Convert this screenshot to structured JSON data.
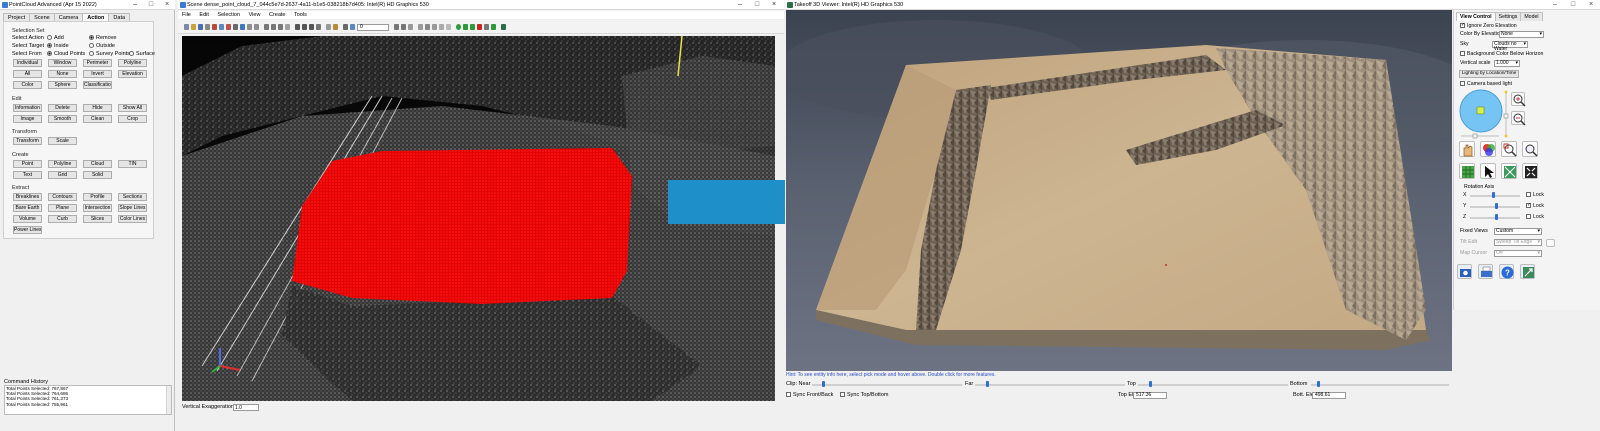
{
  "left_window": {
    "title": "PointCloud Advanced (Apr 15 2022)",
    "tabs": [
      "Project",
      "Scene",
      "Camera",
      "Action",
      "Data"
    ],
    "active_tab": "Action",
    "selection_set": {
      "heading": "Selection Set",
      "select_action_label": "Select Action",
      "action_add": "Add",
      "action_remove": "Remove",
      "select_target_label": "Select Target",
      "target_inside": "Inside",
      "target_outside": "Outside",
      "select_from_label": "Select From",
      "from_cloud": "Cloud Points",
      "from_survey": "Survey Points",
      "from_surface": "Surface",
      "buttons": [
        "Individual",
        "Window",
        "Perimeter",
        "Polyline",
        "All",
        "None",
        "Invert",
        "Elevation",
        "Color",
        "Sphere",
        "Classification"
      ]
    },
    "edit": {
      "heading": "Edit",
      "buttons": [
        "Information",
        "Delete",
        "Hide",
        "Show All",
        "Image",
        "Smooth",
        "Clean",
        "Crop"
      ]
    },
    "transform": {
      "heading": "Transform",
      "buttons": [
        "Transform",
        "Scale"
      ]
    },
    "create": {
      "heading": "Create",
      "buttons": [
        "Point",
        "Polyline",
        "Cloud",
        "TIN",
        "Text",
        "Grid",
        "Solid"
      ]
    },
    "extract": {
      "heading": "Extract",
      "buttons": [
        "Breaklines",
        "Contours",
        "Profile",
        "Sections",
        "Bare Earth",
        "Plane",
        "Intersection",
        "Slope Lines",
        "Volume",
        "Curb",
        "Slices",
        "Color Lines",
        "Power Lines"
      ]
    },
    "history": {
      "label": "Command History",
      "lines": [
        "Total Points Selected: 767,867",
        "Total Points Selected: 764,686",
        "Total Points Selected: 761,373",
        "Total Points Selected: 755,961"
      ]
    }
  },
  "scene_window": {
    "title": "Scene dense_point_cloud_7_044c5e7d-2637-4a11-b1e5-038218b7d405: Intel(R) HD Graphics 530",
    "menu": [
      "File",
      "Edit",
      "Selection",
      "View",
      "Create",
      "Tools"
    ],
    "toolbar_field": "0",
    "vertical_exag_label": "Vertical Exaggeration",
    "vertical_exag_value": "1.0"
  },
  "takeoff_window": {
    "title": "Takeoff 3D Viewer: Intel(R) HD Graphics 530",
    "hint": "Hint: To see entity info here, select pick mode and hover above. Double click for more features.",
    "clip_near": "Clip: Near",
    "far": "Far",
    "top": "Top",
    "bottom": "Bottom",
    "sync_front_back": "Sync Front/Back",
    "sync_top_bottom": "Sync Top/Bottom",
    "top_elev_label": "Top Elev",
    "top_elev_value": "517.36",
    "bott_elev_label": "Bott. Elev.",
    "bott_elev_value": "498.61"
  },
  "view_control": {
    "tabs": [
      "View Control",
      "Settings",
      "Model"
    ],
    "ignore_zero_elev": "Ignore Zero Elevation",
    "color_by_elev_label": "Color By Elevation",
    "color_by_elev_value": "None",
    "sky_label": "Sky",
    "sky_value": "Clouds no Water",
    "bg_color_below": "Background Color Below Horizon",
    "vertical_scale_label": "Vertical scale",
    "vertical_scale_value": "1.000",
    "lighting_btn": "Lighting by Location/Time",
    "camera_light": "Camera based light",
    "rotation_axis": "Rotation Axis",
    "axis_x": "X",
    "axis_y": "Y",
    "axis_z": "Z",
    "lock": "Lock",
    "fixed_views_label": "Fixed Views",
    "fixed_views_value": "Custom",
    "tilt_edit_label": "Tilt Edit",
    "tilt_edit_value": "Sweep Tilt Edge",
    "map_cursor_label": "Map Cursor",
    "map_cursor_value": "Off"
  },
  "colors": {
    "accent": "#2f6fd4",
    "arrow": "#1e8fc8",
    "selection": "#ff1010",
    "terrain": "#c8b08c"
  }
}
